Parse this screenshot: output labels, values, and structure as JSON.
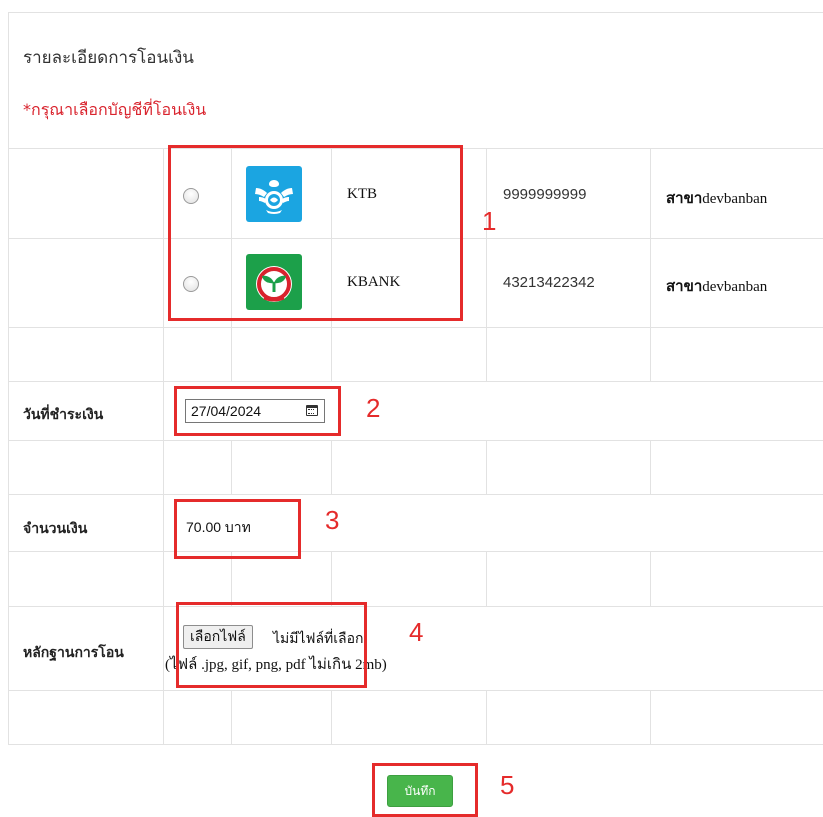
{
  "section": {
    "heading": "รายละเอียดการโอนเงิน",
    "warning": "*กรุณาเลือกบัญชีที่โอนเงิน"
  },
  "banks": [
    {
      "code": "KTB",
      "account_number": "9999999999",
      "branch_prefix": "สาขา",
      "branch_name": "devbanban",
      "logo_icon": "ktb-garuda-icon",
      "logo_color": "#1ba5e1"
    },
    {
      "code": "KBANK",
      "account_number": "43213422342",
      "branch_prefix": "สาขา",
      "branch_name": "devbanban",
      "logo_icon": "kbank-leaf-icon",
      "logo_color": "#1ca04a"
    }
  ],
  "payment_date": {
    "label": "วันที่ชำระเงิน",
    "value": "27/04/2024"
  },
  "amount": {
    "label": "จำนวนเงิน",
    "value": "70.00 บาท"
  },
  "evidence": {
    "label": "หลักฐานการโอน",
    "choose_button": "เลือกไฟล์",
    "no_file": "ไม่มีไฟล์ที่เลือก",
    "note": "(ไฟล์ .jpg, gif, png, pdf ไม่เกิน 2mb)"
  },
  "save_button": "บันทึก",
  "annotations": [
    "1",
    "2",
    "3",
    "4",
    "5"
  ],
  "colors": {
    "warning": "#d9232d",
    "annotation": "#e52b2b",
    "save_button": "#48b54b"
  }
}
